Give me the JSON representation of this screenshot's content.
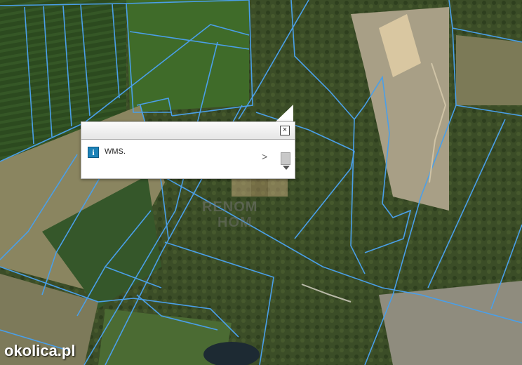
{
  "popup": {
    "close_symbol": "×",
    "info_symbol": "i",
    "layer_label": "WMS.",
    "next_symbol": ">"
  },
  "watermark": {
    "line1": "RENOM",
    "line2": "HOM"
  },
  "brand": {
    "text": "okolica.pl"
  },
  "colors": {
    "parcel_line": "#4a9fe8",
    "field_dark": "#2f4a22",
    "field_light": "#7b8a4a",
    "quarry": "#b9ae95"
  }
}
